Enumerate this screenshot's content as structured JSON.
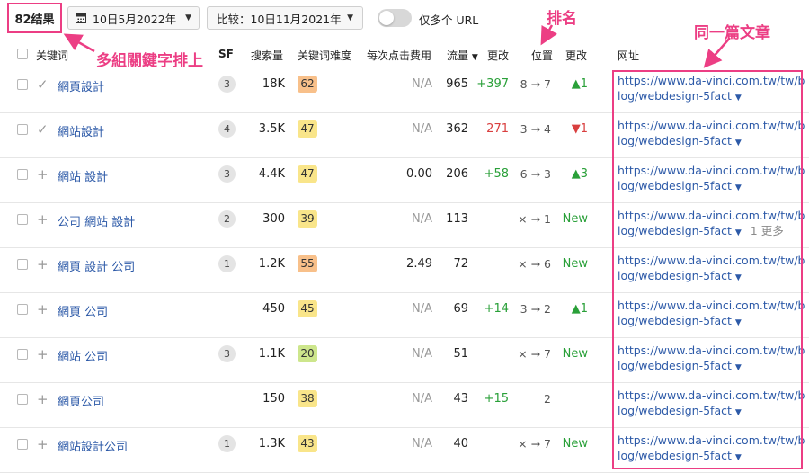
{
  "toolbar": {
    "results": "82结果",
    "date": "10日5月2022年",
    "compare": "比较：10日11月2021年",
    "url_toggle_label": "仅多个 URL"
  },
  "columns": {
    "keyword": "关键词",
    "sf": "SF",
    "volume": "搜索量",
    "kd": "关键词难度",
    "cpc": "每次点击费用",
    "traffic": "流量",
    "traffic_change": "更改",
    "position": "位置",
    "position_change": "更改",
    "url": "网址"
  },
  "colors": {
    "accent": "#ec3e84",
    "link": "#2d5aa8",
    "positive": "#2aa039",
    "negative": "#d93f3f",
    "kd_orange": "#f8c08a",
    "kd_yellow": "#f9e58a",
    "kd_green": "#cde68c"
  },
  "rows": [
    {
      "icon": "✓",
      "keyword": "網頁設計",
      "sf": "3",
      "volume": "18K",
      "kd": "62",
      "kd_color": "#f8c08a",
      "cpc": "N/A",
      "traffic": "965",
      "traffic_change": "+397",
      "tc_type": "pos",
      "position": "8 → 7",
      "position_change": "▲1",
      "pc_type": "pos",
      "url1": "https://www.da-vinci.com.tw/tw/b",
      "url2": "log/webdesign-5fact",
      "more": ""
    },
    {
      "icon": "✓",
      "keyword": "網站設計",
      "sf": "4",
      "volume": "3.5K",
      "kd": "47",
      "kd_color": "#f9e58a",
      "cpc": "N/A",
      "traffic": "362",
      "traffic_change": "–271",
      "tc_type": "neg",
      "position": "3 → 4",
      "position_change": "▼1",
      "pc_type": "neg",
      "url1": "https://www.da-vinci.com.tw/tw/b",
      "url2": "log/webdesign-5fact",
      "more": ""
    },
    {
      "icon": "+",
      "keyword": "網站 設計",
      "sf": "3",
      "volume": "4.4K",
      "kd": "47",
      "kd_color": "#f9e58a",
      "cpc": "0.00",
      "traffic": "206",
      "traffic_change": "+58",
      "tc_type": "pos",
      "position": "6 → 3",
      "position_change": "▲3",
      "pc_type": "pos",
      "url1": "https://www.da-vinci.com.tw/tw/b",
      "url2": "log/webdesign-5fact",
      "more": ""
    },
    {
      "icon": "+",
      "keyword": "公司 網站 設計",
      "sf": "2",
      "volume": "300",
      "kd": "39",
      "kd_color": "#f9e58a",
      "cpc": "N/A",
      "traffic": "113",
      "traffic_change": "",
      "tc_type": "pos",
      "position": "× → 1",
      "position_change": "New",
      "pc_type": "new",
      "url1": "https://www.da-vinci.com.tw/tw/b",
      "url2": "log/webdesign-5fact",
      "more": "1 更多"
    },
    {
      "icon": "+",
      "keyword": "網頁 設計 公司",
      "sf": "1",
      "volume": "1.2K",
      "kd": "55",
      "kd_color": "#f8c08a",
      "cpc": "2.49",
      "traffic": "72",
      "traffic_change": "",
      "tc_type": "pos",
      "position": "× → 6",
      "position_change": "New",
      "pc_type": "new",
      "url1": "https://www.da-vinci.com.tw/tw/b",
      "url2": "log/webdesign-5fact",
      "more": ""
    },
    {
      "icon": "+",
      "keyword": "網頁 公司",
      "sf": "",
      "volume": "450",
      "kd": "45",
      "kd_color": "#f9e58a",
      "cpc": "N/A",
      "traffic": "69",
      "traffic_change": "+14",
      "tc_type": "pos",
      "position": "3 → 2",
      "position_change": "▲1",
      "pc_type": "pos",
      "url1": "https://www.da-vinci.com.tw/tw/b",
      "url2": "log/webdesign-5fact",
      "more": ""
    },
    {
      "icon": "+",
      "keyword": "網站 公司",
      "sf": "3",
      "volume": "1.1K",
      "kd": "20",
      "kd_color": "#cde68c",
      "cpc": "N/A",
      "traffic": "51",
      "traffic_change": "",
      "tc_type": "pos",
      "position": "× → 7",
      "position_change": "New",
      "pc_type": "new",
      "url1": "https://www.da-vinci.com.tw/tw/b",
      "url2": "log/webdesign-5fact",
      "more": ""
    },
    {
      "icon": "+",
      "keyword": "網頁公司",
      "sf": "",
      "volume": "150",
      "kd": "38",
      "kd_color": "#f9e58a",
      "cpc": "N/A",
      "traffic": "43",
      "traffic_change": "+15",
      "tc_type": "pos",
      "position": "2",
      "position_change": "",
      "pc_type": "pos",
      "url1": "https://www.da-vinci.com.tw/tw/b",
      "url2": "log/webdesign-5fact",
      "more": ""
    },
    {
      "icon": "+",
      "keyword": "網站設計公司",
      "sf": "1",
      "volume": "1.3K",
      "kd": "43",
      "kd_color": "#f9e58a",
      "cpc": "N/A",
      "traffic": "40",
      "traffic_change": "",
      "tc_type": "pos",
      "position": "× → 7",
      "position_change": "New",
      "pc_type": "new",
      "url1": "https://www.da-vinci.com.tw/tw/b",
      "url2": "log/webdesign-5fact",
      "more": ""
    }
  ],
  "annotations": {
    "keywords_note": "多組關鍵字排上",
    "rank_note": "排名",
    "same_article_note": "同一篇文章"
  }
}
